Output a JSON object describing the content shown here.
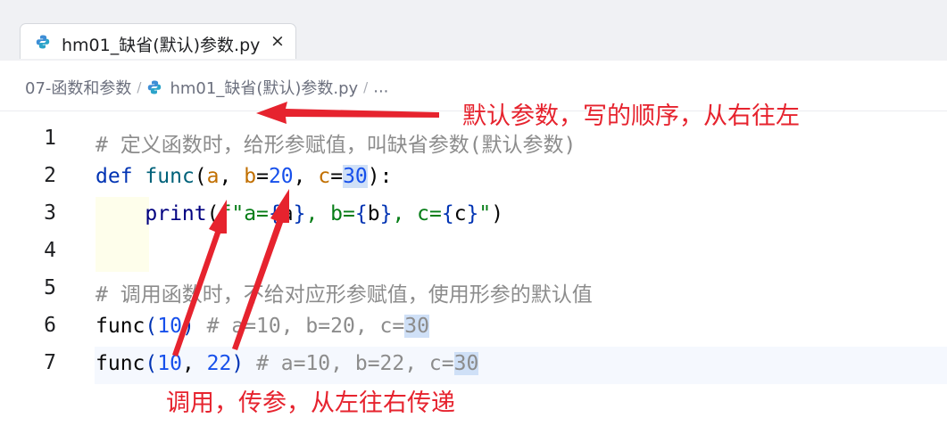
{
  "tab": {
    "label": "hm01_缺省(默认)参数.py",
    "close": "×"
  },
  "breadcrumb": {
    "folder": "07-函数和参数",
    "file": "hm01_缺省(默认)参数.py",
    "more": "..."
  },
  "code": {
    "line1": {
      "num": "1",
      "comment": "# 定义函数时，给形参赋值，叫缺省参数(默认参数)"
    },
    "line2": {
      "num": "2",
      "kw": "def",
      "name": "func",
      "open": "(",
      "a": "a",
      "comma1": ", ",
      "b": "b",
      "eq1": "=",
      "v20": "20",
      "comma2": ", ",
      "c": "c",
      "eq2": "=",
      "v30": "30",
      "close": "):"
    },
    "line3": {
      "num": "3",
      "print": "print",
      "open": "(",
      "fstr1": "f\"a=",
      "ob1": "{",
      "a": "a",
      "cb1": "}",
      "fstr2": ", b=",
      "ob2": "{",
      "b": "b",
      "cb2": "}",
      "fstr3": ", c=",
      "ob3": "{",
      "c": "c",
      "cb3": "}",
      "fstr4": "\"",
      "close": ")"
    },
    "line4": {
      "num": "4"
    },
    "line5": {
      "num": "5",
      "comment": "# 调用函数时，不给对应形参赋值，使用形参的默认值"
    },
    "line6": {
      "num": "6",
      "name": "func",
      "open": "(",
      "arg1": "10",
      "close": ")",
      "comment_pre": " # a=10, b=20, c=",
      "comment_sel": "30"
    },
    "line7": {
      "num": "7",
      "name": "func",
      "open": "(",
      "arg1": "10",
      "comma": ", ",
      "arg2": "22",
      "close": ")",
      "comment_pre": " # a=10, b=22, c=",
      "comment_sel": "30"
    }
  },
  "annotations": {
    "top": "默认参数，写的顺序，从右往左",
    "bottom": "调用，传参，从左往右传递"
  },
  "colors": {
    "annotation": "#e6232e",
    "keyword": "#0033b3",
    "number": "#1750eb",
    "string": "#067d17"
  }
}
